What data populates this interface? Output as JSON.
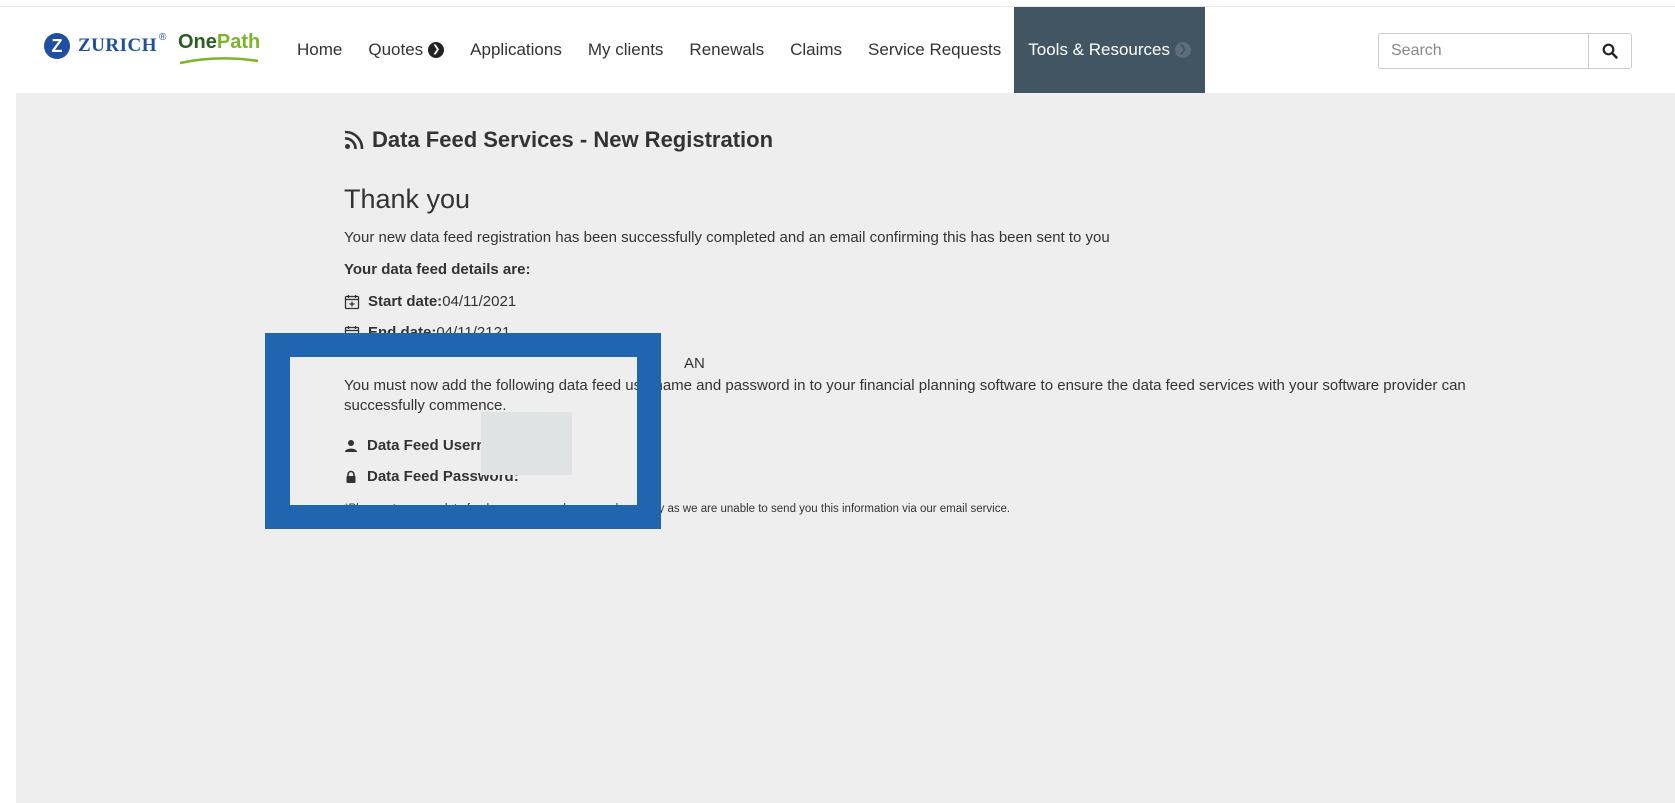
{
  "brand": {
    "zurich_mark": "Z",
    "zurich_name": "ZURICH",
    "zurich_reg": "®",
    "onepath_part1": "One",
    "onepath_part2": "Path"
  },
  "nav": {
    "items": [
      {
        "label": "Home",
        "has_caret": false
      },
      {
        "label": "Quotes",
        "has_caret": true
      },
      {
        "label": "Applications",
        "has_caret": false
      },
      {
        "label": "My clients",
        "has_caret": false
      },
      {
        "label": "Renewals",
        "has_caret": false
      },
      {
        "label": "Claims",
        "has_caret": false
      },
      {
        "label": "Service Requests",
        "has_caret": false
      },
      {
        "label": "Tools & Resources",
        "has_caret": true,
        "active": true
      }
    ],
    "active_bg": "#415563"
  },
  "search": {
    "placeholder": "Search",
    "icon": "search-icon"
  },
  "page": {
    "title": "Data Feed Services - New Registration",
    "title_icon": "rss-feed-icon",
    "heading": "Thank you",
    "confirmation": "Your new data feed registration has been successfully completed and an email confirming this has been sent to you",
    "details_heading": "Your data feed details are:",
    "start_label": "Start date:",
    "start_value": "04/11/2021",
    "end_label": "End date:",
    "end_value": " 04/11/2121",
    "partial_value": "AN",
    "instructions": "You must now add the following data feed username and password in to your financial planning software to ensure the data feed services with your software provider can successfully commence.",
    "username_label": "Data Feed Username:",
    "password_label": "Data Feed Password:",
    "note": "*Please store your data feed username and password securely as we are unable to send you this information via our email service."
  },
  "colors": {
    "zurich_blue": "#1f4ea5",
    "onepath_dark": "#2a5f22",
    "onepath_light": "#7bb52a",
    "content_bg": "#eeeeee",
    "redaction_blue": "#1f65af"
  }
}
